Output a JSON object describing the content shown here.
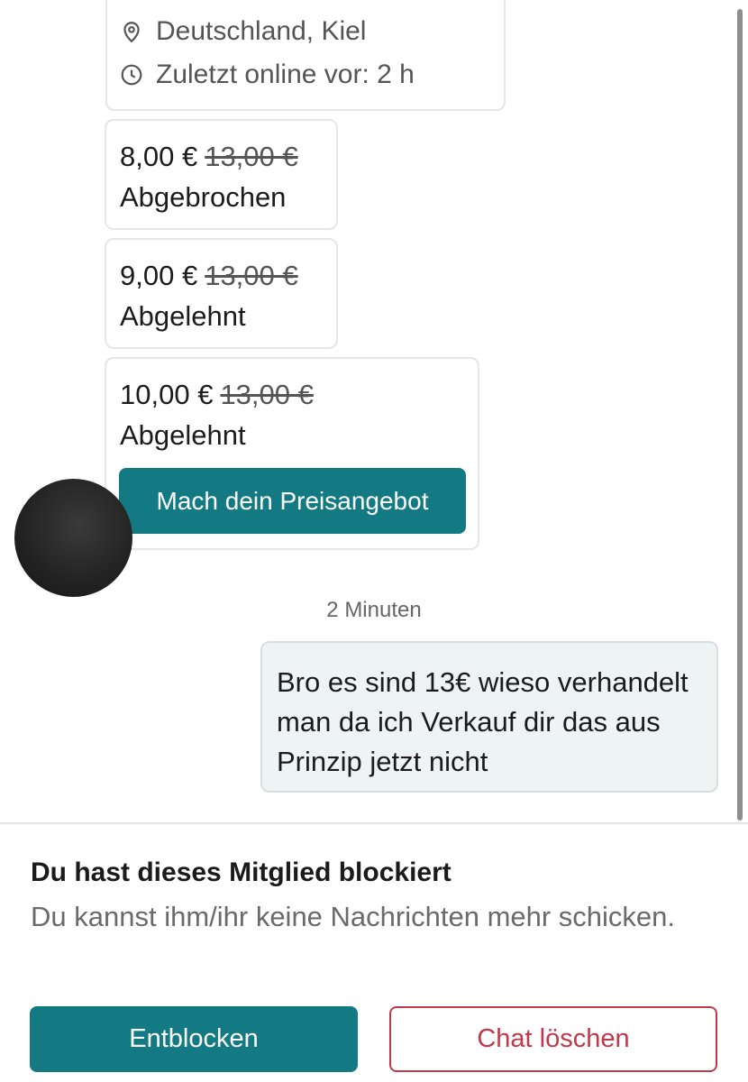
{
  "profile": {
    "location": "Deutschland, Kiel",
    "last_online": "Zuletzt online vor: 2 h",
    "location_icon": "location-pin-icon",
    "clock_icon": "clock-icon"
  },
  "offers": [
    {
      "price": "8,00 €",
      "original_price": "13,00 €",
      "status": "Abgebrochen"
    },
    {
      "price": "9,00 €",
      "original_price": "13,00 €",
      "status": "Abgelehnt"
    },
    {
      "price": "10,00 €",
      "original_price": "13,00 €",
      "status": "Abgelehnt"
    }
  ],
  "offer_button_label": "Mach dein Preisangebot",
  "timestamp": "2 Minuten",
  "own_message": "Bro es sind 13€ wieso verhandelt man da ich Verkauf dir das aus Prinzip jetzt nicht",
  "blocked": {
    "title": "Du hast dieses Mitglied blockiert",
    "text": "Du kannst ihm/ihr keine Nachrichten mehr schicken."
  },
  "buttons": {
    "unblock": "Entblocken",
    "delete_chat": "Chat löschen"
  },
  "colors": {
    "accent": "#137a84",
    "danger": "#c0394a"
  }
}
